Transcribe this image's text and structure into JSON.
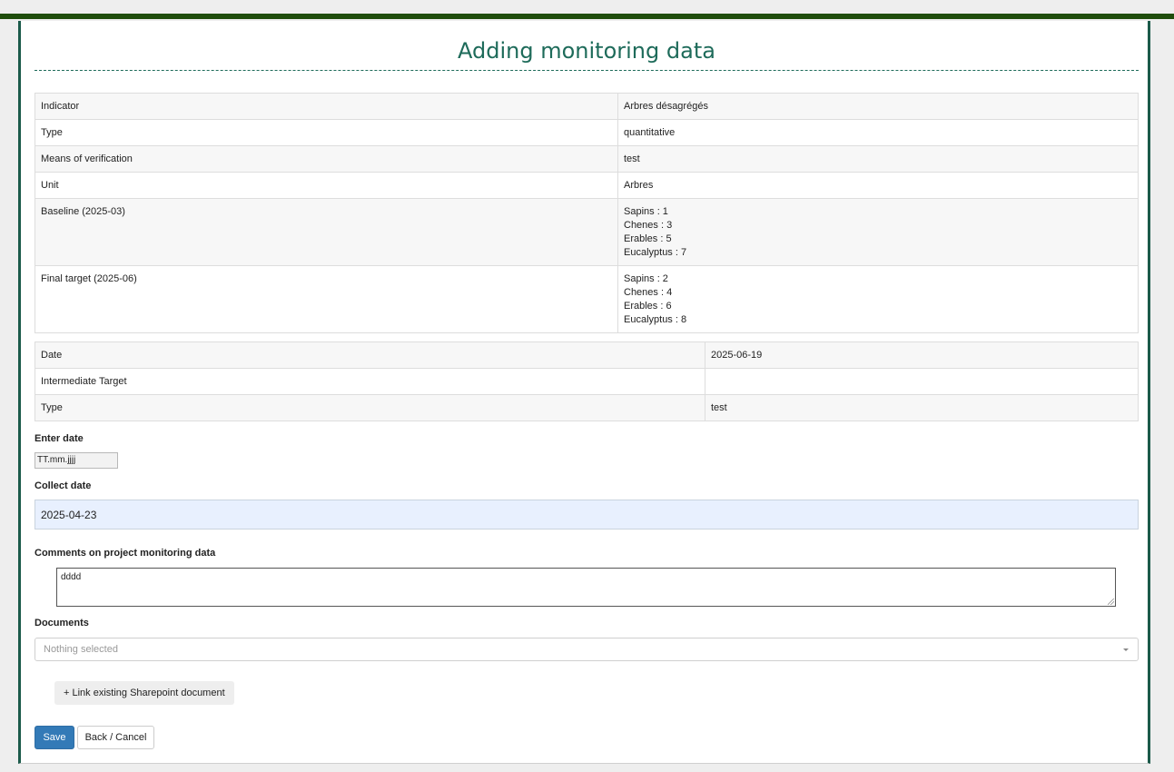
{
  "page": {
    "title": "Adding monitoring data"
  },
  "indicator_table": {
    "rows": [
      {
        "label": "Indicator",
        "value": "Arbres désagrégés"
      },
      {
        "label": "Type",
        "value": "quantitative"
      },
      {
        "label": "Means of verification",
        "value": "test"
      },
      {
        "label": "Unit",
        "value": "Arbres"
      },
      {
        "label": "Baseline (2025-03)",
        "lines": [
          "Sapins : 1",
          "Chenes : 3",
          "Erables : 5",
          "Eucalyptus : 7"
        ]
      },
      {
        "label": "Final target (2025-06)",
        "lines": [
          "Sapins : 2",
          "Chenes : 4",
          "Erables : 6",
          "Eucalyptus : 8"
        ]
      }
    ]
  },
  "milestone_table": {
    "rows": [
      {
        "label": "Date",
        "value": "2025-06-19"
      },
      {
        "label": "Intermediate Target",
        "value": ""
      },
      {
        "label": "Type",
        "value": "test"
      }
    ]
  },
  "form": {
    "enter_date_label": "Enter date",
    "enter_date_placeholder": "TT.mm.jjjj",
    "collect_date_label": "Collect date",
    "collect_date_value": "2025-04-23",
    "comments_label": "Comments on project monitoring data",
    "comments_value": "dddd",
    "documents_label": "Documents",
    "documents_placeholder": "Nothing selected",
    "link_sharepoint_label": "+ Link existing Sharepoint document",
    "save_label": "Save",
    "cancel_label": "Back / Cancel"
  },
  "colors": {
    "top_bar": "#1f4d0c",
    "accent": "#1e6b5a",
    "primary_button": "#337ab7"
  }
}
